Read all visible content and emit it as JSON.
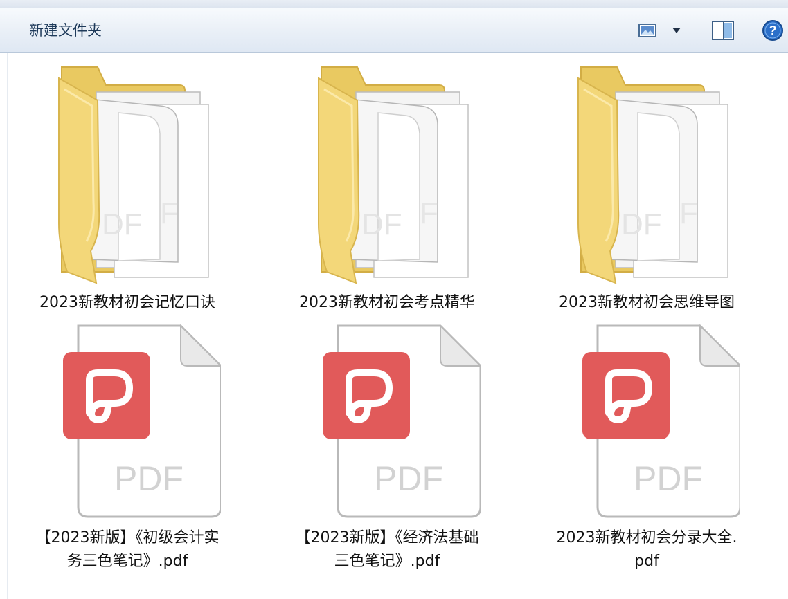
{
  "toolbar": {
    "new_folder_label": "新建文件夹"
  },
  "colors": {
    "folder_back": "#f2d77a",
    "folder_front": "#f6de84",
    "pdf_badge": "#e15a5a",
    "pdf_text": "#d2d2d2"
  },
  "files": [
    {
      "type": "folder",
      "name": "2023新教材初会记忆口诀"
    },
    {
      "type": "folder",
      "name": "2023新教材初会考点精华"
    },
    {
      "type": "folder",
      "name": "2023新教材初会思维导图"
    },
    {
      "type": "pdf",
      "name_line1": "【2023新版】《初级会计实",
      "name_line2": "务三色笔记》.pdf",
      "icon_text": "PDF"
    },
    {
      "type": "pdf",
      "name_line1": "【2023新版】《经济法基础",
      "name_line2": "三色笔记》.pdf",
      "icon_text": "PDF"
    },
    {
      "type": "pdf",
      "name_line1": "2023新教材初会分录大全.",
      "name_line2": "pdf",
      "icon_text": "PDF"
    }
  ]
}
